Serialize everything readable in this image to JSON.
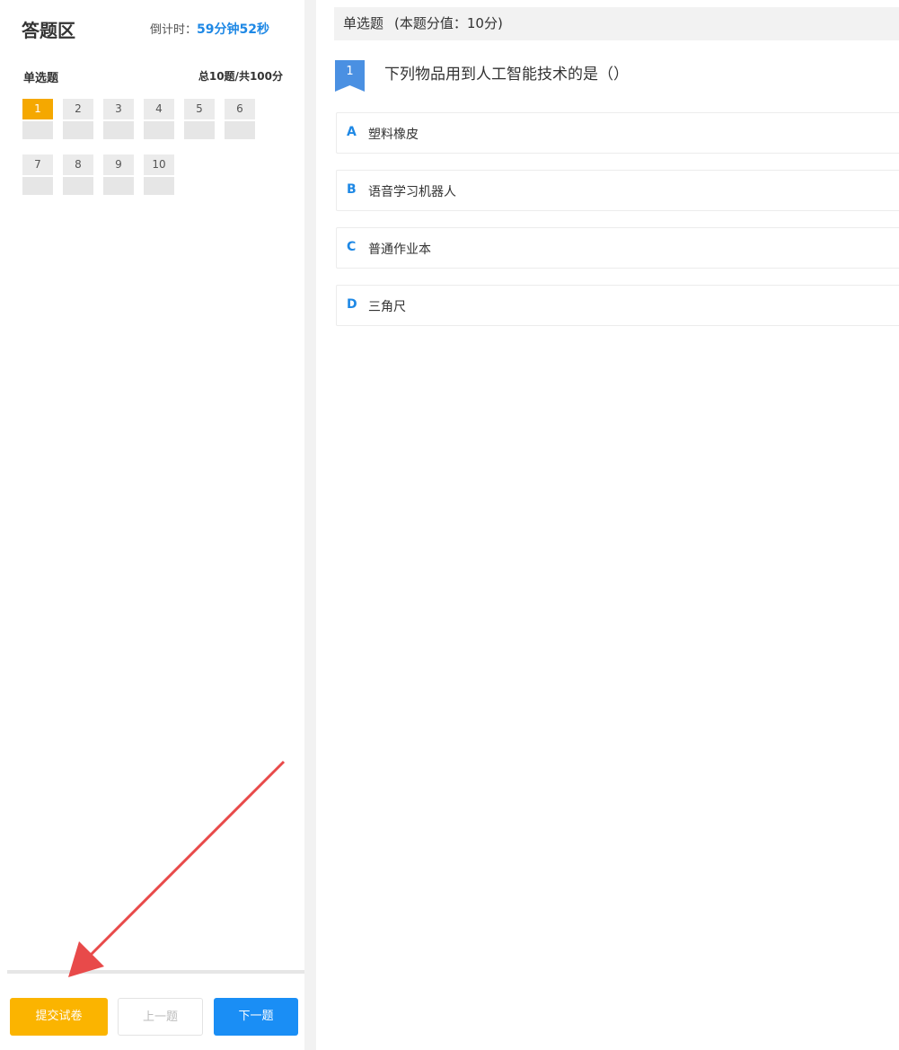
{
  "sidebar": {
    "title": "答题区",
    "timer_label": "倒计时：",
    "timer_value": "59分钟52秒",
    "section_title": "单选题",
    "section_total": "总10题/共100分",
    "questions": [
      "1",
      "2",
      "3",
      "4",
      "5",
      "6",
      "7",
      "8",
      "9",
      "10"
    ],
    "active_question": "1",
    "buttons": {
      "submit": "提交试卷",
      "prev": "上一题",
      "next": "下一题"
    }
  },
  "main": {
    "header_type": "单选题",
    "header_points": "(本题分值：10分)",
    "question_number": "1",
    "question_text": "下列物品用到人工智能技术的是（）",
    "options": [
      {
        "letter": "A",
        "text": "塑料橡皮"
      },
      {
        "letter": "B",
        "text": "语音学习机器人"
      },
      {
        "letter": "C",
        "text": "普通作业本"
      },
      {
        "letter": "D",
        "text": "三角尺"
      }
    ]
  },
  "colors": {
    "accent_blue": "#1a8ef5",
    "accent_orange": "#fbb400",
    "annotation_red": "#e84a4a"
  }
}
